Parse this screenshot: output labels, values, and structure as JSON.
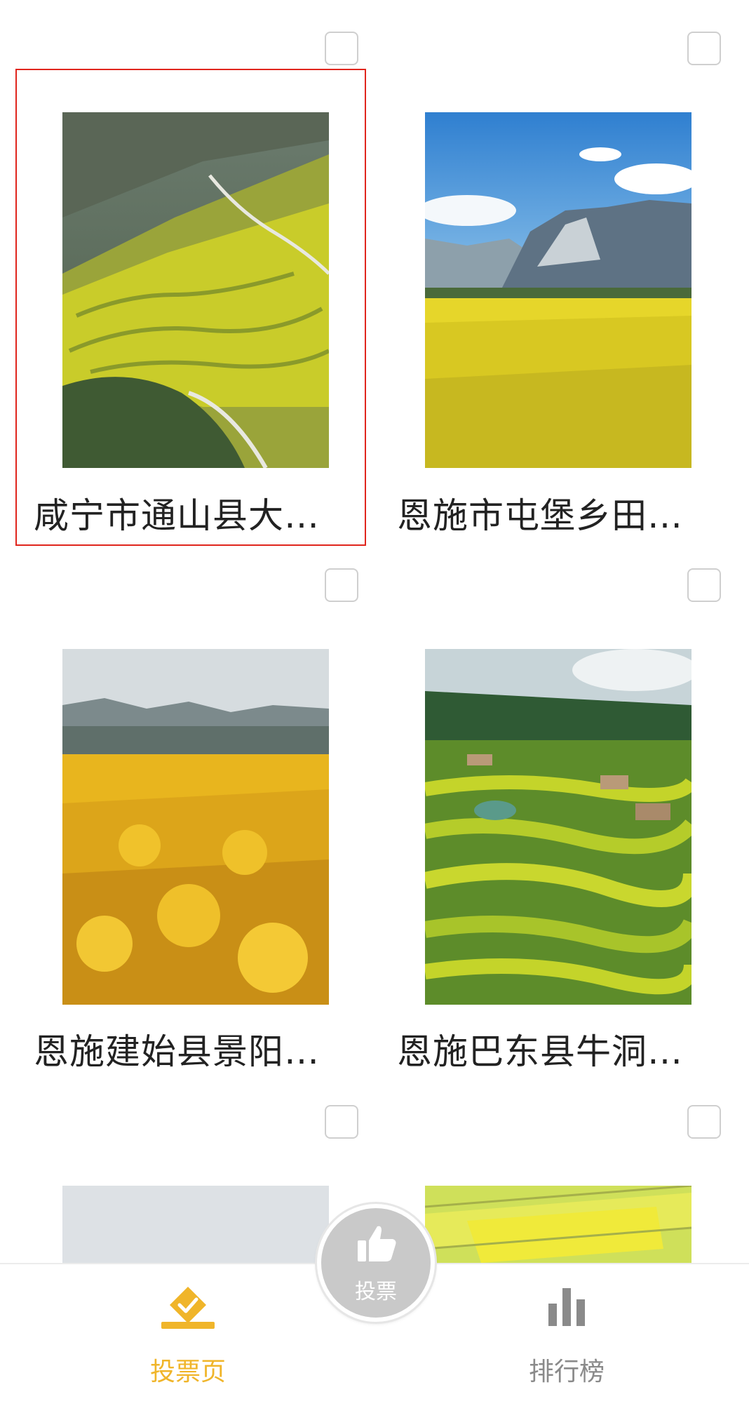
{
  "items": [
    {
      "caption": "咸宁市通山县大…",
      "selected": true
    },
    {
      "caption": "恩施市屯堡乡田…",
      "selected": false
    },
    {
      "caption": "恩施建始县景阳…",
      "selected": false
    },
    {
      "caption": "恩施巴东县牛洞…",
      "selected": false
    },
    {
      "caption": "",
      "selected": false
    },
    {
      "caption": "",
      "selected": false
    }
  ],
  "fab": {
    "label": "投票",
    "icon": "thumbs-up-icon"
  },
  "tabs": [
    {
      "label": "投票页",
      "icon": "vote-box-icon",
      "active": true
    },
    {
      "label": "排行榜",
      "icon": "bar-chart-icon",
      "active": false
    }
  ],
  "colors": {
    "accent": "#f0b52a",
    "tab_inactive": "#8a8a8a",
    "selection_border": "#e0251d"
  }
}
